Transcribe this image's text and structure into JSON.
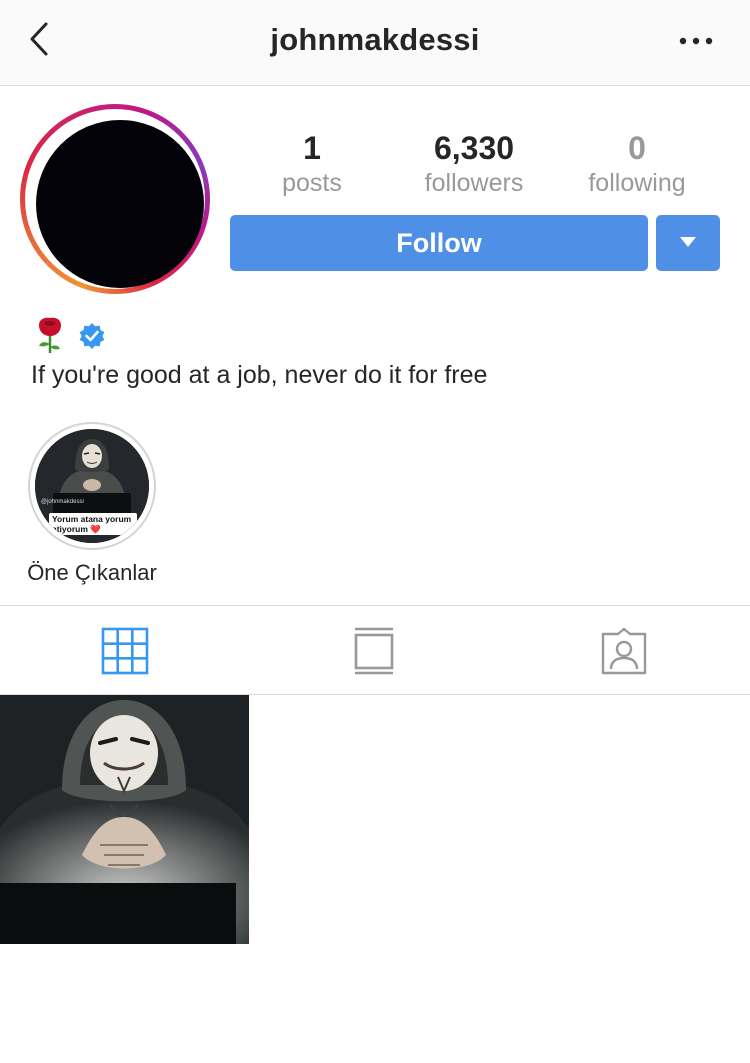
{
  "header": {
    "title": "johnmakdessi",
    "back_icon": "chevron-left-icon",
    "more_icon": "ellipsis-icon"
  },
  "profile": {
    "stats": [
      {
        "value": "1",
        "label": "posts"
      },
      {
        "value": "6,330",
        "label": "followers"
      },
      {
        "value": "0",
        "label": "following"
      }
    ],
    "follow_label": "Follow",
    "dropdown_icon": "caret-down-icon",
    "bio_icons": [
      "rose-emoji",
      "verified-badge-icon"
    ],
    "bio": "If you're good at a job, never do it for free"
  },
  "highlights": [
    {
      "label": "Öne Çıkanlar",
      "username_overlay": "@johnmakdessi",
      "caption": "Yorum atana yorum atiyorum ❤️"
    }
  ],
  "tabs": [
    {
      "icon": "grid-icon",
      "active": true
    },
    {
      "icon": "feed-icon",
      "active": false
    },
    {
      "icon": "tagged-icon",
      "active": false
    }
  ],
  "posts": [
    {
      "thumbnail": "masked-figure-at-laptop"
    }
  ],
  "colors": {
    "accent": "#4f8fe6",
    "active_tab": "#3897f0",
    "inactive_tab": "#999999",
    "text": "#262626",
    "muted": "#999999",
    "verified": "#3897f0"
  }
}
